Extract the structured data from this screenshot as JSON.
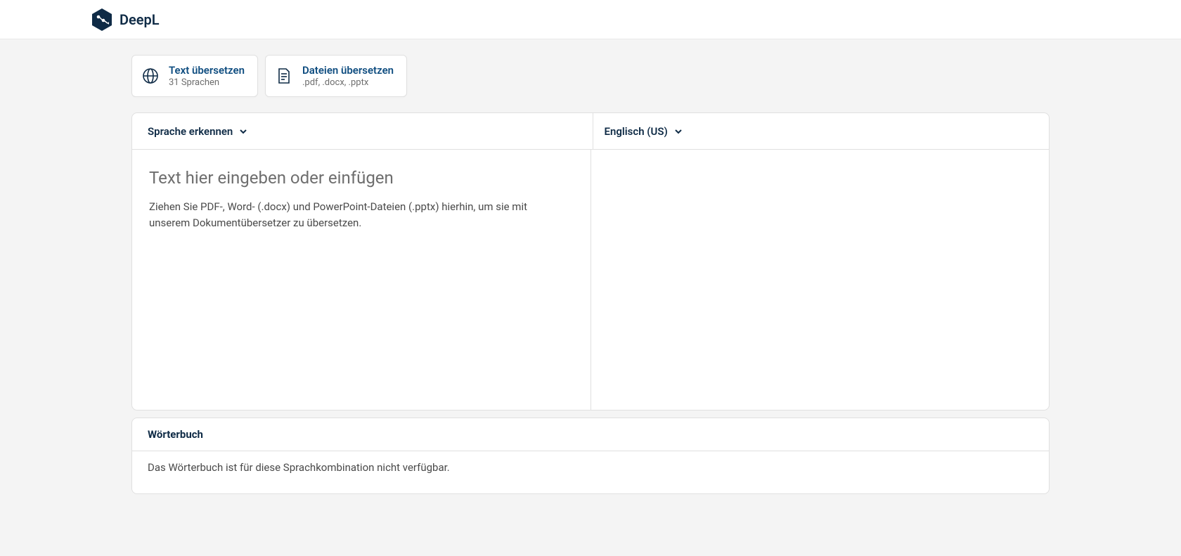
{
  "header": {
    "brand": "DeepL"
  },
  "tabs": {
    "text": {
      "title": "Text übersetzen",
      "subtitle": "31 Sprachen"
    },
    "files": {
      "title": "Dateien übersetzen",
      "subtitle": ".pdf, .docx, .pptx"
    }
  },
  "translator": {
    "source_lang": "Sprache erkennen",
    "target_lang": "Englisch (US)",
    "placeholder_title": "Text hier eingeben oder einfügen",
    "placeholder_desc": "Ziehen Sie PDF-, Word- (.docx) und PowerPoint-Dateien (.pptx) hierhin, um sie mit unserem Dokumentübersetzer zu übersetzen."
  },
  "dictionary": {
    "title": "Wörterbuch",
    "message": "Das Wörterbuch ist für diese Sprachkombination nicht verfügbar."
  }
}
